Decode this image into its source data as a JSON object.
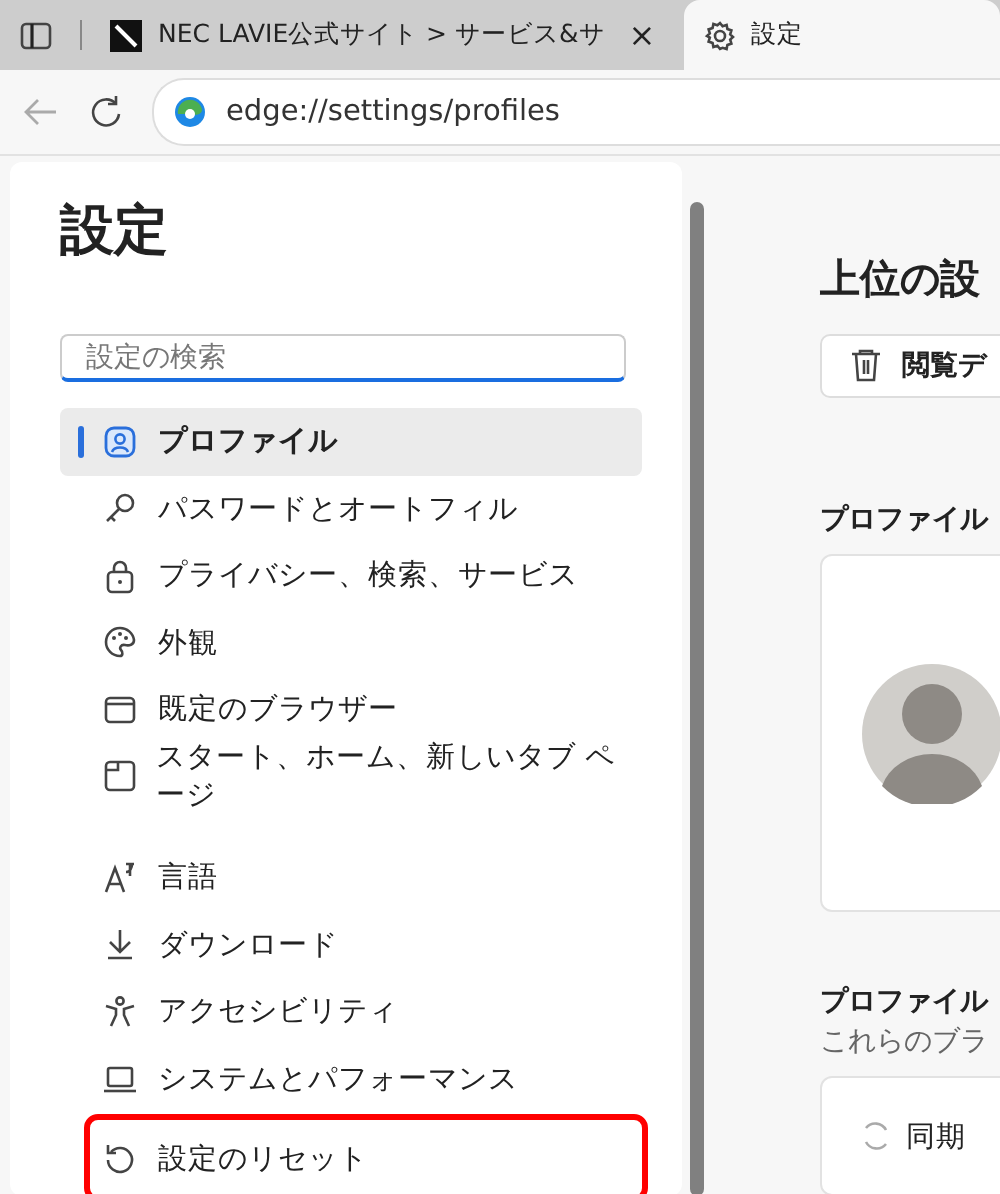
{
  "browser_tabs": [
    {
      "title": "NEC LAVIE公式サイト > サービス&サ",
      "close": "×",
      "selected": false
    },
    {
      "title": "設定",
      "selected": true
    }
  ],
  "address_bar": {
    "url": "edge://settings/profiles"
  },
  "sidebar": {
    "title": "設定",
    "search": {
      "placeholder": "設定の検索"
    },
    "groups": [
      [
        {
          "label": "プロファイル",
          "selected": true,
          "highlighted": false
        },
        {
          "label": "パスワードとオートフィル",
          "selected": false,
          "highlighted": false
        },
        {
          "label": "プライバシー、検索、サービス",
          "selected": false,
          "highlighted": false
        },
        {
          "label": "外観",
          "selected": false,
          "highlighted": false
        },
        {
          "label": "既定のブラウザー",
          "selected": false,
          "highlighted": false
        },
        {
          "label": "スタート、ホーム、新しいタブ ページ",
          "selected": false,
          "highlighted": false
        }
      ],
      [
        {
          "label": "言語",
          "selected": false,
          "highlighted": false
        },
        {
          "label": "ダウンロード",
          "selected": false,
          "highlighted": false
        },
        {
          "label": "アクセシビリティ",
          "selected": false,
          "highlighted": false
        },
        {
          "label": "システムとパフォーマンス",
          "selected": false,
          "highlighted": false
        },
        {
          "label": "設定のリセット",
          "selected": false,
          "highlighted": true
        }
      ]
    ]
  },
  "main": {
    "heading": "上位の設",
    "clear_button": "閲覧デ",
    "profile_section": {
      "title": "プロファイル"
    },
    "sync_section": {
      "title": "プロファイル",
      "subtitle": "これらのブラ",
      "sync_label": "同期"
    }
  }
}
